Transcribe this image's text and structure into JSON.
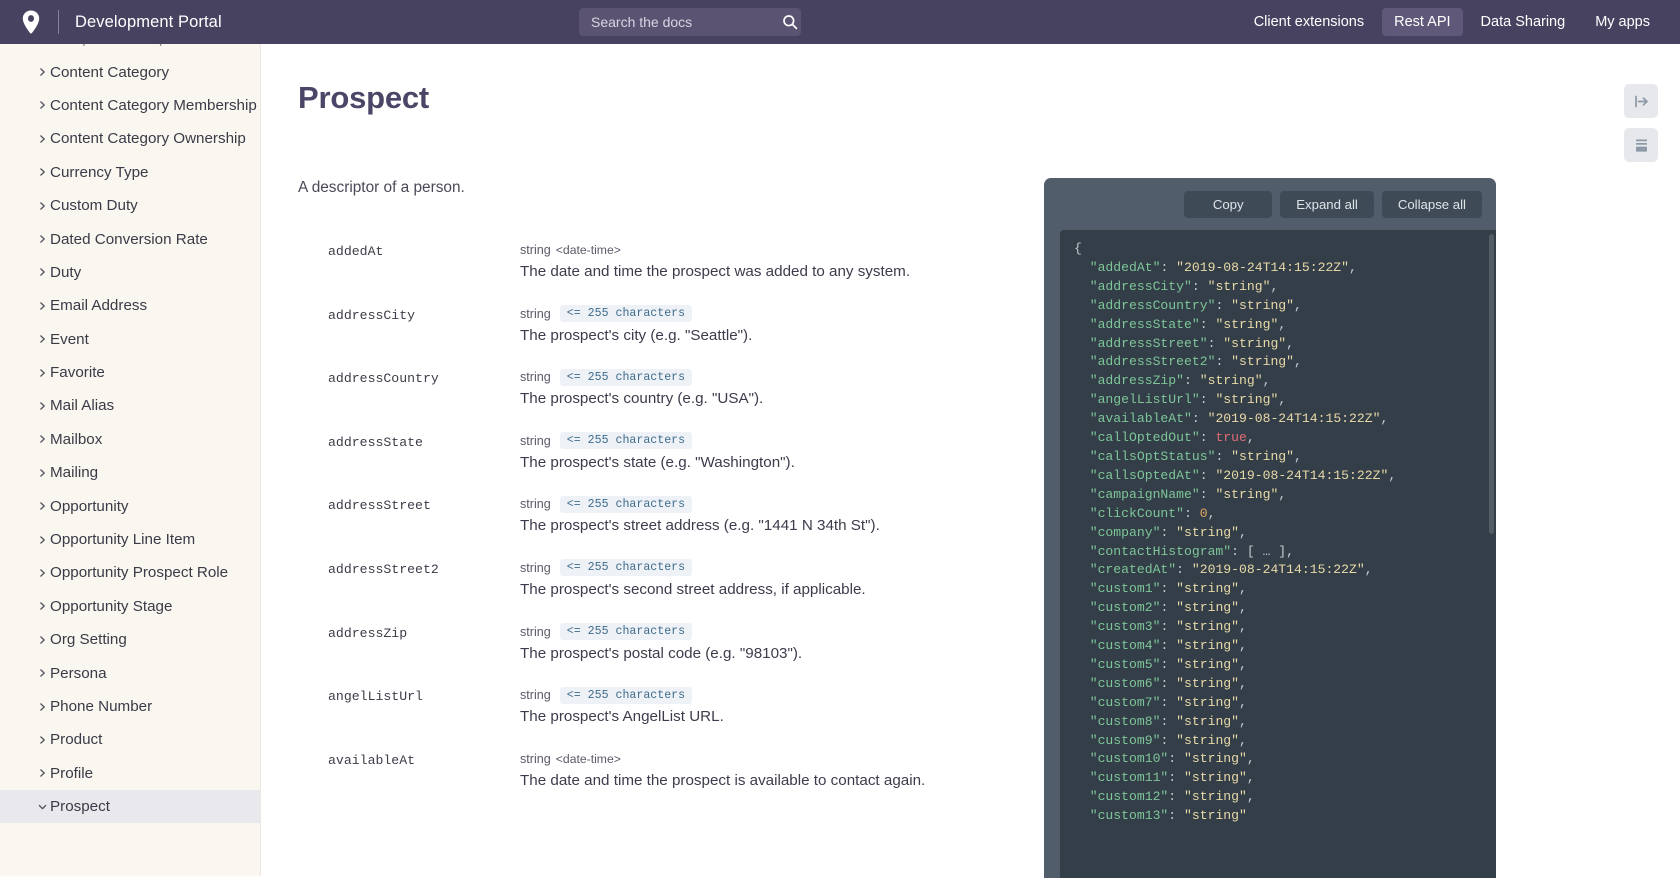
{
  "header": {
    "logo_icon": "location-pin-icon",
    "brand_title": "Development Portal",
    "search": {
      "placeholder": "Search the docs",
      "value": "",
      "icon": "search-icon"
    },
    "nav": [
      {
        "label": "Client extensions",
        "active": false
      },
      {
        "label": "Rest API",
        "active": true
      },
      {
        "label": "Data Sharing",
        "active": false
      },
      {
        "label": "My apps",
        "active": false
      }
    ]
  },
  "sidebar": {
    "items": [
      {
        "label": "Compliance Request",
        "state": "collapsed",
        "partial": true
      },
      {
        "label": "Content Category",
        "state": "collapsed"
      },
      {
        "label": "Content Category Membership",
        "state": "collapsed"
      },
      {
        "label": "Content Category Ownership",
        "state": "collapsed"
      },
      {
        "label": "Currency Type",
        "state": "collapsed"
      },
      {
        "label": "Custom Duty",
        "state": "collapsed"
      },
      {
        "label": "Dated Conversion Rate",
        "state": "collapsed"
      },
      {
        "label": "Duty",
        "state": "collapsed"
      },
      {
        "label": "Email Address",
        "state": "collapsed"
      },
      {
        "label": "Event",
        "state": "collapsed"
      },
      {
        "label": "Favorite",
        "state": "collapsed"
      },
      {
        "label": "Mail Alias",
        "state": "collapsed"
      },
      {
        "label": "Mailbox",
        "state": "collapsed"
      },
      {
        "label": "Mailing",
        "state": "collapsed"
      },
      {
        "label": "Opportunity",
        "state": "collapsed"
      },
      {
        "label": "Opportunity Line Item",
        "state": "collapsed"
      },
      {
        "label": "Opportunity Prospect Role",
        "state": "collapsed"
      },
      {
        "label": "Opportunity Stage",
        "state": "collapsed"
      },
      {
        "label": "Org Setting",
        "state": "collapsed"
      },
      {
        "label": "Persona",
        "state": "collapsed"
      },
      {
        "label": "Phone Number",
        "state": "collapsed"
      },
      {
        "label": "Product",
        "state": "collapsed"
      },
      {
        "label": "Profile",
        "state": "collapsed"
      },
      {
        "label": "Prospect",
        "state": "expanded",
        "active": true
      }
    ]
  },
  "main": {
    "title": "Prospect",
    "description": "A descriptor of a person.",
    "properties": [
      {
        "name": "addedAt",
        "type": "string",
        "format": "<date-time>",
        "badge": "",
        "description": "The date and time the prospect was added to any system."
      },
      {
        "name": "addressCity",
        "type": "string",
        "format": "",
        "badge": "<= 255 characters",
        "description": "The prospect's city (e.g. \"Seattle\")."
      },
      {
        "name": "addressCountry",
        "type": "string",
        "format": "",
        "badge": "<= 255 characters",
        "description": "The prospect's country (e.g. \"USA\")."
      },
      {
        "name": "addressState",
        "type": "string",
        "format": "",
        "badge": "<= 255 characters",
        "description": "The prospect's state (e.g. \"Washington\")."
      },
      {
        "name": "addressStreet",
        "type": "string",
        "format": "",
        "badge": "<= 255 characters",
        "description": "The prospect's street address (e.g. \"1441 N 34th St\")."
      },
      {
        "name": "addressStreet2",
        "type": "string",
        "format": "",
        "badge": "<= 255 characters",
        "description": "The prospect's second street address, if applicable."
      },
      {
        "name": "addressZip",
        "type": "string",
        "format": "",
        "badge": "<= 255 characters",
        "description": "The prospect's postal code (e.g. \"98103\")."
      },
      {
        "name": "angelListUrl",
        "type": "string",
        "format": "",
        "badge": "<= 255 characters",
        "description": "The prospect's AngelList URL."
      },
      {
        "name": "availableAt",
        "type": "string",
        "format": "<date-time>",
        "badge": "",
        "description": "The date and time the prospect is available to contact again."
      }
    ]
  },
  "float_buttons": [
    {
      "icon": "collapse-right-arrow-icon",
      "name": "toggle-panel-button"
    },
    {
      "icon": "panel-layout-icon",
      "name": "layout-toggle-button"
    }
  ],
  "code_panel": {
    "buttons": [
      {
        "label": "Copy",
        "name": "copy-button"
      },
      {
        "label": "Expand all",
        "name": "expand-all-button"
      },
      {
        "label": "Collapse all",
        "name": "collapse-all-button"
      }
    ],
    "lines": [
      {
        "fold": "",
        "tokens": [
          {
            "t": "p",
            "v": "{"
          }
        ]
      },
      {
        "fold": "",
        "tokens": [
          {
            "t": "k",
            "v": "  \"addedAt\""
          },
          {
            "t": "p",
            "v": ": "
          },
          {
            "t": "s",
            "v": "\"2019-08-24T14:15:22Z\""
          },
          {
            "t": "p",
            "v": ","
          }
        ]
      },
      {
        "fold": "",
        "tokens": [
          {
            "t": "k",
            "v": "  \"addressCity\""
          },
          {
            "t": "p",
            "v": ": "
          },
          {
            "t": "s",
            "v": "\"string\""
          },
          {
            "t": "p",
            "v": ","
          }
        ]
      },
      {
        "fold": "",
        "tokens": [
          {
            "t": "k",
            "v": "  \"addressCountry\""
          },
          {
            "t": "p",
            "v": ": "
          },
          {
            "t": "s",
            "v": "\"string\""
          },
          {
            "t": "p",
            "v": ","
          }
        ]
      },
      {
        "fold": "",
        "tokens": [
          {
            "t": "k",
            "v": "  \"addressState\""
          },
          {
            "t": "p",
            "v": ": "
          },
          {
            "t": "s",
            "v": "\"string\""
          },
          {
            "t": "p",
            "v": ","
          }
        ]
      },
      {
        "fold": "",
        "tokens": [
          {
            "t": "k",
            "v": "  \"addressStreet\""
          },
          {
            "t": "p",
            "v": ": "
          },
          {
            "t": "s",
            "v": "\"string\""
          },
          {
            "t": "p",
            "v": ","
          }
        ]
      },
      {
        "fold": "",
        "tokens": [
          {
            "t": "k",
            "v": "  \"addressStreet2\""
          },
          {
            "t": "p",
            "v": ": "
          },
          {
            "t": "s",
            "v": "\"string\""
          },
          {
            "t": "p",
            "v": ","
          }
        ]
      },
      {
        "fold": "",
        "tokens": [
          {
            "t": "k",
            "v": "  \"addressZip\""
          },
          {
            "t": "p",
            "v": ": "
          },
          {
            "t": "s",
            "v": "\"string\""
          },
          {
            "t": "p",
            "v": ","
          }
        ]
      },
      {
        "fold": "",
        "tokens": [
          {
            "t": "k",
            "v": "  \"angelListUrl\""
          },
          {
            "t": "p",
            "v": ": "
          },
          {
            "t": "s",
            "v": "\"string\""
          },
          {
            "t": "p",
            "v": ","
          }
        ]
      },
      {
        "fold": "",
        "tokens": [
          {
            "t": "k",
            "v": "  \"availableAt\""
          },
          {
            "t": "p",
            "v": ": "
          },
          {
            "t": "s",
            "v": "\"2019-08-24T14:15:22Z\""
          },
          {
            "t": "p",
            "v": ","
          }
        ]
      },
      {
        "fold": "",
        "tokens": [
          {
            "t": "k",
            "v": "  \"callOptedOut\""
          },
          {
            "t": "p",
            "v": ": "
          },
          {
            "t": "b",
            "v": "true"
          },
          {
            "t": "p",
            "v": ","
          }
        ]
      },
      {
        "fold": "",
        "tokens": [
          {
            "t": "k",
            "v": "  \"callsOptStatus\""
          },
          {
            "t": "p",
            "v": ": "
          },
          {
            "t": "s",
            "v": "\"string\""
          },
          {
            "t": "p",
            "v": ","
          }
        ]
      },
      {
        "fold": "",
        "tokens": [
          {
            "t": "k",
            "v": "  \"callsOptedAt\""
          },
          {
            "t": "p",
            "v": ": "
          },
          {
            "t": "s",
            "v": "\"2019-08-24T14:15:22Z\""
          },
          {
            "t": "p",
            "v": ","
          }
        ]
      },
      {
        "fold": "",
        "tokens": [
          {
            "t": "k",
            "v": "  \"campaignName\""
          },
          {
            "t": "p",
            "v": ": "
          },
          {
            "t": "s",
            "v": "\"string\""
          },
          {
            "t": "p",
            "v": ","
          }
        ]
      },
      {
        "fold": "",
        "tokens": [
          {
            "t": "k",
            "v": "  \"clickCount\""
          },
          {
            "t": "p",
            "v": ": "
          },
          {
            "t": "n",
            "v": "0"
          },
          {
            "t": "p",
            "v": ","
          }
        ]
      },
      {
        "fold": "",
        "tokens": [
          {
            "t": "k",
            "v": "  \"company\""
          },
          {
            "t": "p",
            "v": ": "
          },
          {
            "t": "s",
            "v": "\"string\""
          },
          {
            "t": "p",
            "v": ","
          }
        ]
      },
      {
        "fold": "+",
        "tokens": [
          {
            "t": "k",
            "v": "  \"contactHistogram\""
          },
          {
            "t": "p",
            "v": ": [ … ],"
          }
        ]
      },
      {
        "fold": "",
        "tokens": [
          {
            "t": "k",
            "v": "  \"createdAt\""
          },
          {
            "t": "p",
            "v": ": "
          },
          {
            "t": "s",
            "v": "\"2019-08-24T14:15:22Z\""
          },
          {
            "t": "p",
            "v": ","
          }
        ]
      },
      {
        "fold": "",
        "tokens": [
          {
            "t": "k",
            "v": "  \"custom1\""
          },
          {
            "t": "p",
            "v": ": "
          },
          {
            "t": "s",
            "v": "\"string\""
          },
          {
            "t": "p",
            "v": ","
          }
        ]
      },
      {
        "fold": "",
        "tokens": [
          {
            "t": "k",
            "v": "  \"custom2\""
          },
          {
            "t": "p",
            "v": ": "
          },
          {
            "t": "s",
            "v": "\"string\""
          },
          {
            "t": "p",
            "v": ","
          }
        ]
      },
      {
        "fold": "",
        "tokens": [
          {
            "t": "k",
            "v": "  \"custom3\""
          },
          {
            "t": "p",
            "v": ": "
          },
          {
            "t": "s",
            "v": "\"string\""
          },
          {
            "t": "p",
            "v": ","
          }
        ]
      },
      {
        "fold": "",
        "tokens": [
          {
            "t": "k",
            "v": "  \"custom4\""
          },
          {
            "t": "p",
            "v": ": "
          },
          {
            "t": "s",
            "v": "\"string\""
          },
          {
            "t": "p",
            "v": ","
          }
        ]
      },
      {
        "fold": "",
        "tokens": [
          {
            "t": "k",
            "v": "  \"custom5\""
          },
          {
            "t": "p",
            "v": ": "
          },
          {
            "t": "s",
            "v": "\"string\""
          },
          {
            "t": "p",
            "v": ","
          }
        ]
      },
      {
        "fold": "",
        "tokens": [
          {
            "t": "k",
            "v": "  \"custom6\""
          },
          {
            "t": "p",
            "v": ": "
          },
          {
            "t": "s",
            "v": "\"string\""
          },
          {
            "t": "p",
            "v": ","
          }
        ]
      },
      {
        "fold": "",
        "tokens": [
          {
            "t": "k",
            "v": "  \"custom7\""
          },
          {
            "t": "p",
            "v": ": "
          },
          {
            "t": "s",
            "v": "\"string\""
          },
          {
            "t": "p",
            "v": ","
          }
        ]
      },
      {
        "fold": "",
        "tokens": [
          {
            "t": "k",
            "v": "  \"custom8\""
          },
          {
            "t": "p",
            "v": ": "
          },
          {
            "t": "s",
            "v": "\"string\""
          },
          {
            "t": "p",
            "v": ","
          }
        ]
      },
      {
        "fold": "",
        "tokens": [
          {
            "t": "k",
            "v": "  \"custom9\""
          },
          {
            "t": "p",
            "v": ": "
          },
          {
            "t": "s",
            "v": "\"string\""
          },
          {
            "t": "p",
            "v": ","
          }
        ]
      },
      {
        "fold": "",
        "tokens": [
          {
            "t": "k",
            "v": "  \"custom10\""
          },
          {
            "t": "p",
            "v": ": "
          },
          {
            "t": "s",
            "v": "\"string\""
          },
          {
            "t": "p",
            "v": ","
          }
        ]
      },
      {
        "fold": "",
        "tokens": [
          {
            "t": "k",
            "v": "  \"custom11\""
          },
          {
            "t": "p",
            "v": ": "
          },
          {
            "t": "s",
            "v": "\"string\""
          },
          {
            "t": "p",
            "v": ","
          }
        ]
      },
      {
        "fold": "",
        "tokens": [
          {
            "t": "k",
            "v": "  \"custom12\""
          },
          {
            "t": "p",
            "v": ": "
          },
          {
            "t": "s",
            "v": "\"string\""
          },
          {
            "t": "p",
            "v": ","
          }
        ]
      },
      {
        "fold": "",
        "tokens": [
          {
            "t": "k",
            "v": "  \"custom13\""
          },
          {
            "t": "p",
            "v": ": "
          },
          {
            "t": "s",
            "v": "\"string\""
          }
        ]
      }
    ]
  },
  "colors": {
    "header_bg": "#474260",
    "sidebar_bg": "#faf6f0",
    "accent": "#4b4668",
    "code_panel_bg": "#515d6b",
    "code_bg": "#333e48",
    "badge_text": "#3e6d8e"
  }
}
